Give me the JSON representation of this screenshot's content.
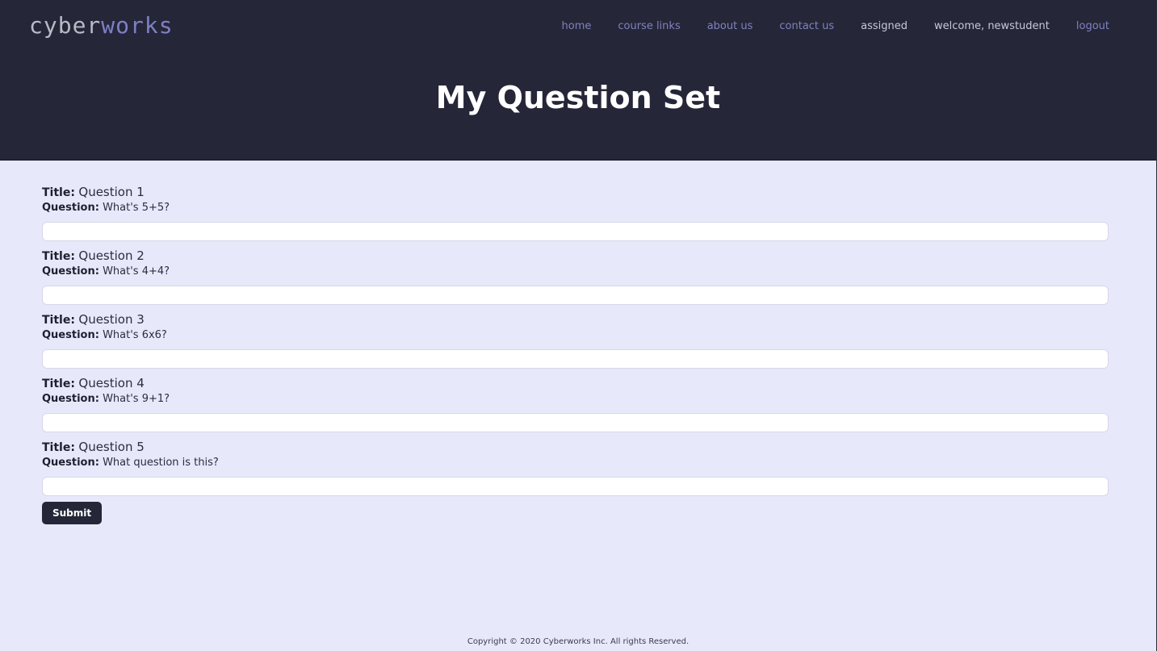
{
  "logo": {
    "part1": "cyber",
    "part2": "works"
  },
  "nav": [
    {
      "label": "home"
    },
    {
      "label": "course links"
    },
    {
      "label": "about us"
    },
    {
      "label": "contact us"
    },
    {
      "label": "assigned"
    },
    {
      "label": "welcome, newstudent"
    },
    {
      "label": "logout"
    }
  ],
  "page": {
    "title": "My Question Set"
  },
  "labels": {
    "title": "Title:",
    "question": "Question:"
  },
  "questions": [
    {
      "title": "Question 1",
      "question": "What's 5+5?",
      "answer": ""
    },
    {
      "title": "Question 2",
      "question": "What's 4+4?",
      "answer": ""
    },
    {
      "title": "Question 3",
      "question": "What's 6x6?",
      "answer": ""
    },
    {
      "title": "Question 4",
      "question": "What's 9+1?",
      "answer": ""
    },
    {
      "title": "Question 5",
      "question": "What question is this?",
      "answer": ""
    }
  ],
  "submit_label": "Submit",
  "footer": {
    "copyright": "Copyright © 2020 Cyberworks Inc. All rights Reserved."
  },
  "colors": {
    "header_bg": "#252638",
    "body_bg": "#e8e8fb",
    "accent": "#7d80c4"
  }
}
